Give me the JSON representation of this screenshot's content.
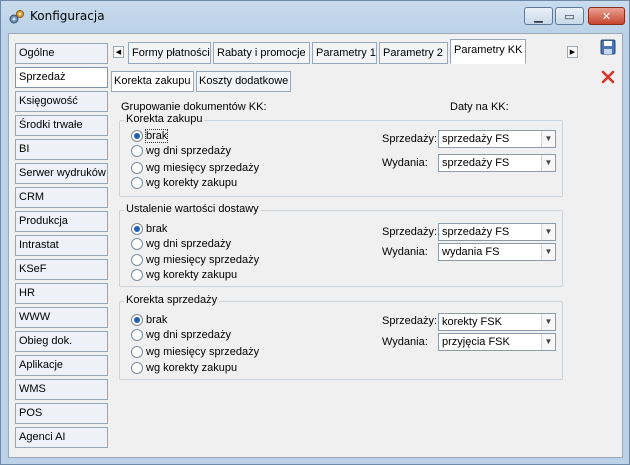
{
  "window": {
    "title": "Konfiguracja"
  },
  "nav": {
    "items": [
      "Ogólne",
      "Sprzedaż",
      "Księgowość",
      "Środki trwałe",
      "BI",
      "Serwer wydruków",
      "CRM",
      "Produkcja",
      "Intrastat",
      "KSeF",
      "HR",
      "WWW",
      "Obieg dok.",
      "Aplikacje",
      "WMS",
      "POS",
      "Agenci AI"
    ],
    "active": "Sprzedaż"
  },
  "tabs": {
    "items": [
      "Formy płatności",
      "Rabaty i promocje",
      "Parametry 1",
      "Parametry 2",
      "Parametry KK"
    ],
    "active": "Parametry KK"
  },
  "subtabs": {
    "items": [
      "Korekta zakupu",
      "Koszty dodatkowe"
    ],
    "active": "Korekta zakupu"
  },
  "main": {
    "grouping_label": "Grupowanie dokumentów KK:",
    "dates_label": "Daty na KK:",
    "sales_label": "Sprzedaży:",
    "issue_label": "Wydania:",
    "radio_options": [
      "brak",
      "wg dni sprzedaży",
      "wg miesięcy sprzedaży",
      "wg korekty zakupu"
    ],
    "groups": [
      {
        "title": "Korekta zakupu",
        "selected": "brak",
        "sales": "sprzedaży FS",
        "issue": "sprzedaży FS"
      },
      {
        "title": "Ustalenie wartości dostawy",
        "selected": "brak",
        "sales": "sprzedaży FS",
        "issue": "wydania FS"
      },
      {
        "title": "Korekta sprzedaży",
        "selected": "brak",
        "sales": "korekty FSK",
        "issue": "przyjęcia FSK"
      }
    ]
  },
  "icons": {
    "save": "save-icon",
    "cancel": "close-icon"
  }
}
